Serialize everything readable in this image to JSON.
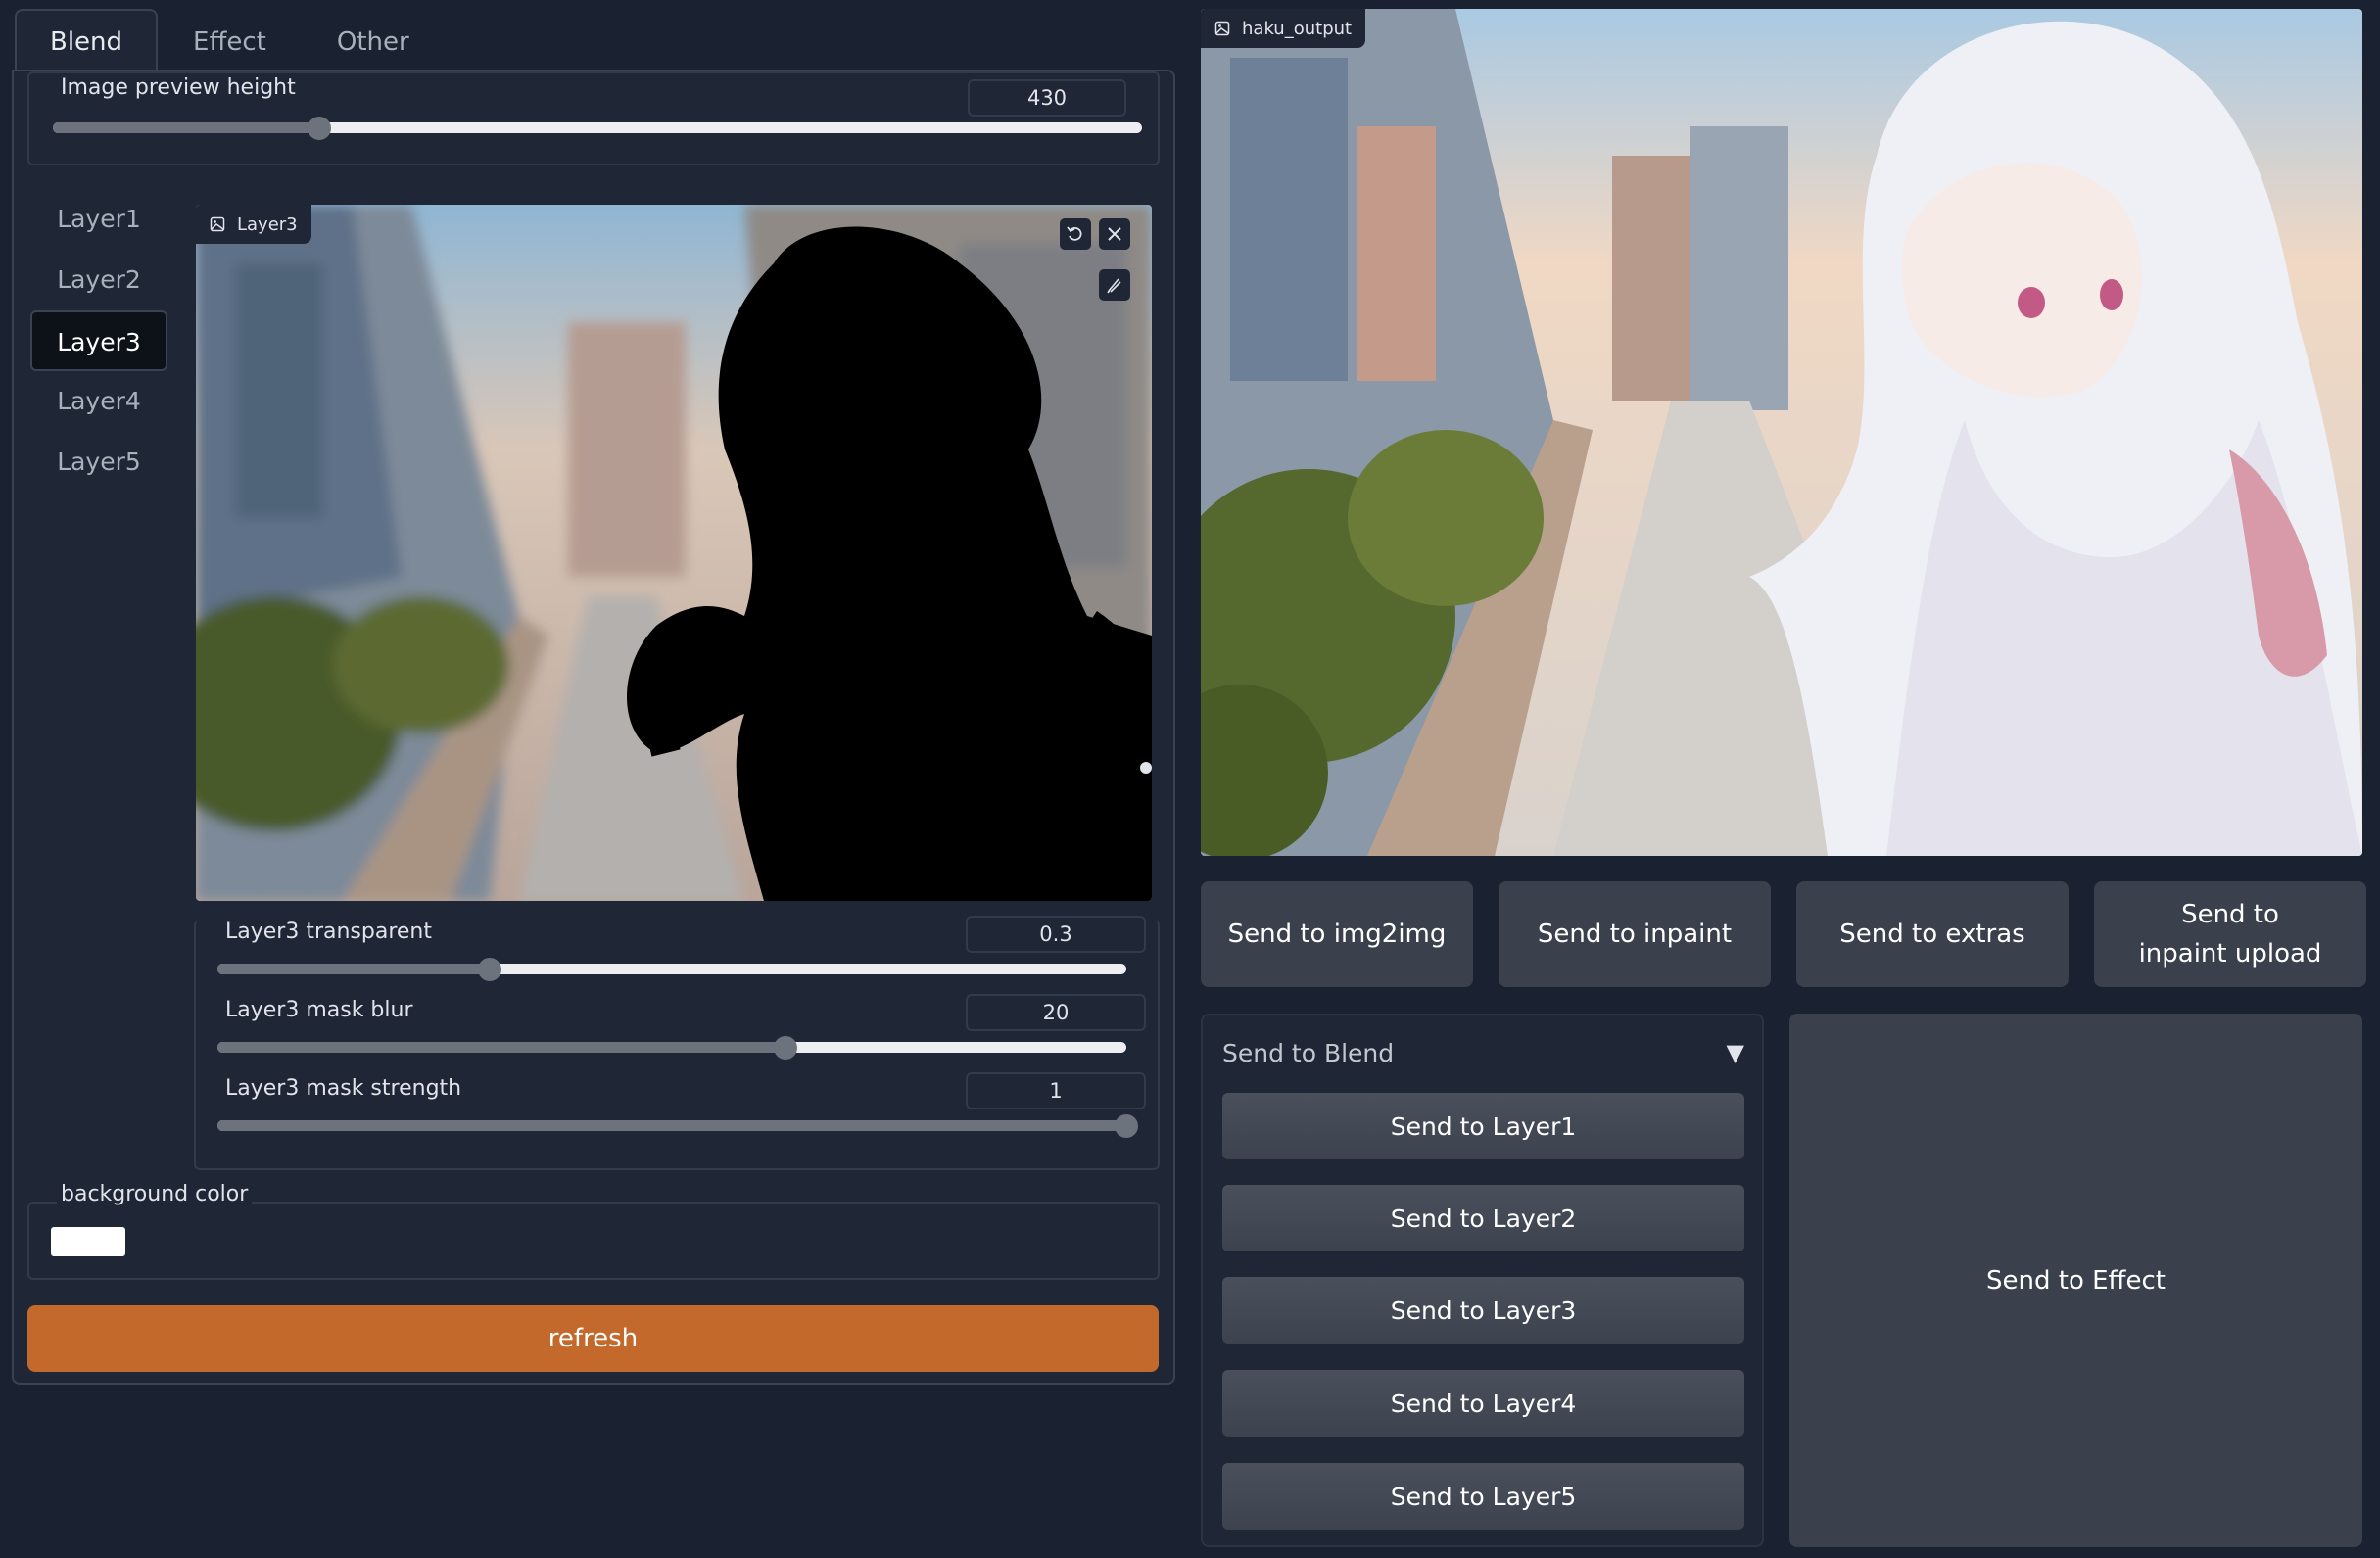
{
  "tabs": [
    "Blend",
    "Effect",
    "Other"
  ],
  "preview": {
    "label": "Image preview height",
    "value": "430",
    "fraction": 0.245
  },
  "layers": [
    "Layer1",
    "Layer2",
    "Layer3",
    "Layer4",
    "Layer5"
  ],
  "active_layer": "Layer3",
  "canvas": {
    "tag": "Layer3"
  },
  "sliders": [
    {
      "label": "Layer3 transparent",
      "value": "0.3",
      "fraction": 0.3
    },
    {
      "label": "Layer3 mask blur",
      "value": "20",
      "fraction": 0.625
    },
    {
      "label": "Layer3 mask strength",
      "value": "1",
      "fraction": 1.0
    }
  ],
  "background_color": {
    "label": "background color",
    "value": "#ffffff"
  },
  "refresh_label": "refresh",
  "output": {
    "tag": "haku_output"
  },
  "send_buttons": [
    "Send to img2img",
    "Send to inpaint",
    "Send to extras",
    "Send to inpaint upload"
  ],
  "blend_panel": {
    "title": "Send to Blend",
    "buttons": [
      "Send to Layer1",
      "Send to Layer2",
      "Send to Layer3",
      "Send to Layer4",
      "Send to Layer5"
    ]
  },
  "effect_label": "Send to Effect",
  "colors": {
    "accent": "#c2692b",
    "bg": "#1a2130",
    "panel": "#1f2736",
    "button": "#3a404c"
  }
}
